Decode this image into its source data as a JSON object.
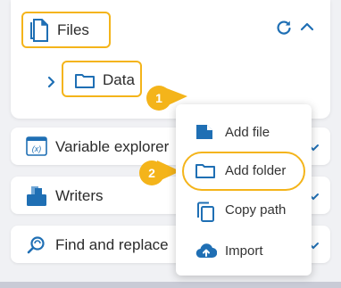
{
  "files": {
    "title": "Files",
    "folder": "Data"
  },
  "panels": [
    {
      "label": "Variable explorer"
    },
    {
      "label": "Writers"
    },
    {
      "label": "Find and replace"
    }
  ],
  "steps": [
    "1",
    "2"
  ],
  "menu": {
    "items": [
      {
        "label": "Add file",
        "icon": "file-icon"
      },
      {
        "label": "Add folder",
        "icon": "folder-icon"
      },
      {
        "label": "Copy path",
        "icon": "copy-icon"
      },
      {
        "label": "Import",
        "icon": "cloud-upload-icon"
      }
    ]
  },
  "colors": {
    "accent": "#1f6fb4",
    "highlight": "#f4b41a"
  }
}
